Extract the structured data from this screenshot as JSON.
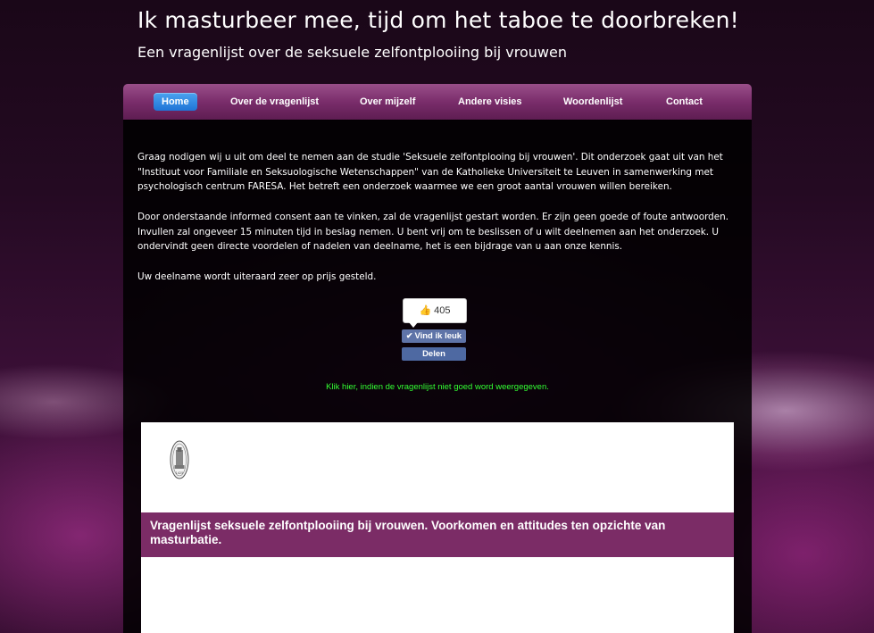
{
  "header": {
    "title": "Ik masturbeer mee, tijd om het taboe te doorbreken!",
    "subtitle": "Een vragenlijst over de seksuele zelfontplooiing bij vrouwen"
  },
  "nav": {
    "items": [
      {
        "label": "Home",
        "active": true
      },
      {
        "label": "Over de vragenlijst",
        "active": false
      },
      {
        "label": "Over mijzelf",
        "active": false
      },
      {
        "label": "Andere visies",
        "active": false
      },
      {
        "label": "Woordenlijst",
        "active": false
      },
      {
        "label": "Contact",
        "active": false
      }
    ]
  },
  "content": {
    "paragraphs": [
      "Graag nodigen wij u uit om deel te nemen aan de studie 'Seksuele zelfontplooing bij vrouwen'. Dit onderzoek gaat uit van het \"Instituut voor Familiale en Seksuologische Wetenschappen\" van de Katholieke Universiteit te Leuven in samenwerking met psychologisch centrum FARESA. Het betreft een onderzoek waarmee we een groot aantal vrouwen willen bereiken.",
      "Door onderstaande informed consent aan te vinken, zal de vragenlijst gestart worden. Er zijn geen goede of foute antwoorden. Invullen zal ongeveer 15 minuten tijd in beslag nemen. U bent vrij om te beslissen of u wilt deelnemen aan het onderzoek. U ondervindt geen directe voordelen of nadelen van deelname, het is een bijdrage van u aan onze kennis.",
      "Uw deelname wordt uiteraard zeer op prijs gesteld."
    ]
  },
  "facebook": {
    "like_count": "405",
    "like_label": "Vind ik leuk",
    "share_label": "Delen",
    "icon": "thumbs-up-icon"
  },
  "fallback_link": "Klik hier, indien de vragenlijst niet goed word weergegeven.",
  "survey": {
    "title": "Vragenlijst seksuele zelfontplooiing bij vrouwen. Voorkomen en attitudes ten opzichte van masturbatie.",
    "seal_year": "1425"
  },
  "colors": {
    "nav": "#7a2d6b",
    "active_tab": "#1f74d6",
    "survey_header": "#7b2c66",
    "link": "#33ff33"
  }
}
